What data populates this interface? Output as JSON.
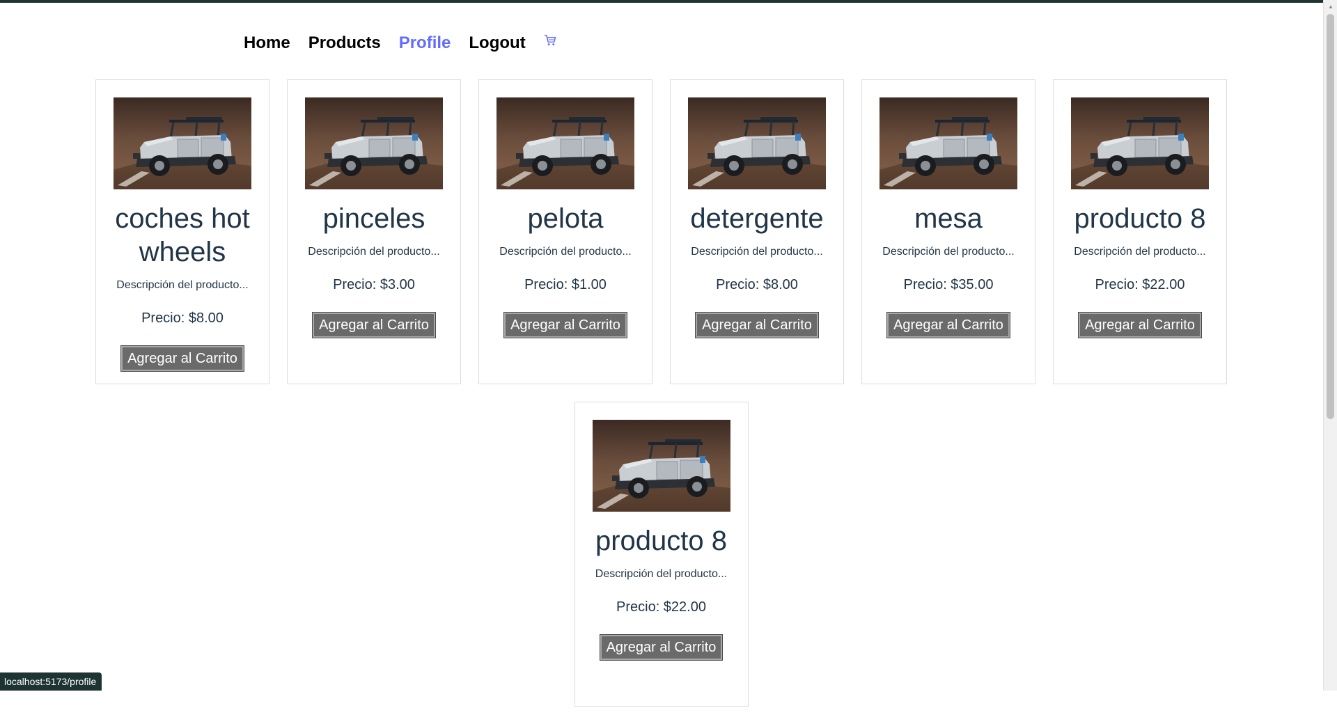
{
  "nav": {
    "items": [
      {
        "label": "Home",
        "active": false
      },
      {
        "label": "Products",
        "active": false
      },
      {
        "label": "Profile",
        "active": true
      },
      {
        "label": "Logout",
        "active": false
      }
    ],
    "cart_icon": "shopping-cart-icon",
    "active_color": "#646cff"
  },
  "products": [
    {
      "name": "coches hot wheels",
      "description": "Descripción del producto...",
      "price": "Precio: $8.00",
      "button": "Agregar al Carrito"
    },
    {
      "name": "pinceles",
      "description": "Descripción del producto...",
      "price": "Precio: $3.00",
      "button": "Agregar al Carrito"
    },
    {
      "name": "pelota",
      "description": "Descripción del producto...",
      "price": "Precio: $1.00",
      "button": "Agregar al Carrito"
    },
    {
      "name": "detergente",
      "description": "Descripción del producto...",
      "price": "Precio: $8.00",
      "button": "Agregar al Carrito"
    },
    {
      "name": "mesa",
      "description": "Descripción del producto...",
      "price": "Precio: $35.00",
      "button": "Agregar al Carrito"
    },
    {
      "name": "producto 8",
      "description": "Descripción del producto...",
      "price": "Precio: $22.00",
      "button": "Agregar al Carrito"
    },
    {
      "name": "producto 8",
      "description": "Descripción del producto...",
      "price": "Precio: $22.00",
      "button": "Agregar al Carrito"
    }
  ],
  "status_bar": {
    "url": "localhost:5173/profile"
  }
}
